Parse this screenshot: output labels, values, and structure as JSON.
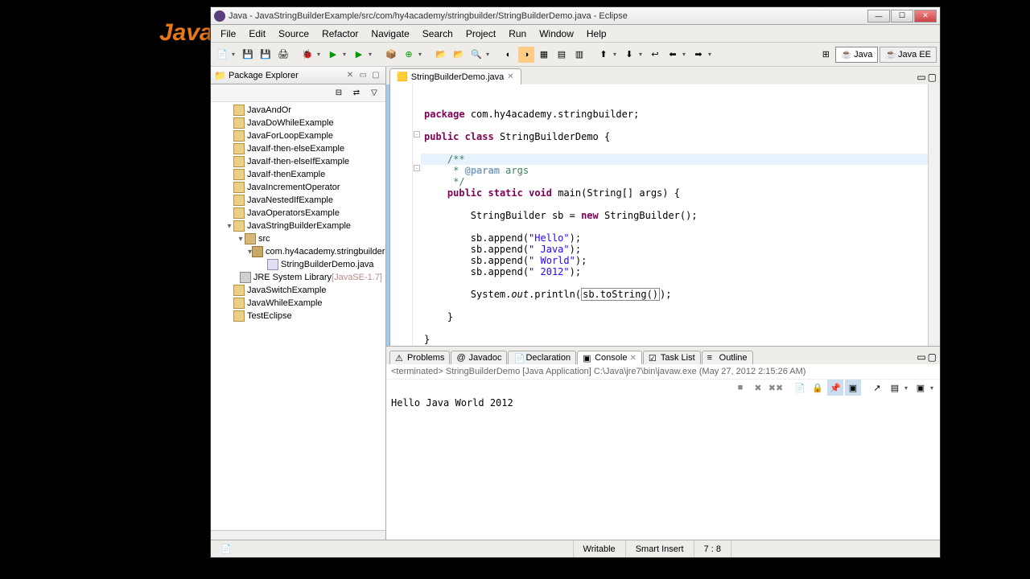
{
  "bg": "Java",
  "title": "Java - JavaStringBuilderExample/src/com/hy4academy/stringbuilder/StringBuilderDemo.java - Eclipse",
  "menu": [
    "File",
    "Edit",
    "Source",
    "Refactor",
    "Navigate",
    "Search",
    "Project",
    "Run",
    "Window",
    "Help"
  ],
  "persp": {
    "java": "Java",
    "javaee": "Java EE"
  },
  "pkg": {
    "title": "Package Explorer",
    "items": [
      {
        "l": "JavaAndOr",
        "t": "proj",
        "d": 1
      },
      {
        "l": "JavaDoWhileExample",
        "t": "proj",
        "d": 1
      },
      {
        "l": "JavaForLoopExample",
        "t": "proj",
        "d": 1
      },
      {
        "l": "JavaIf-then-elseExample",
        "t": "proj",
        "d": 1
      },
      {
        "l": "JavaIf-then-elseIfExample",
        "t": "proj",
        "d": 1
      },
      {
        "l": "JavaIf-thenExample",
        "t": "proj",
        "d": 1
      },
      {
        "l": "JavaIncrementOperator",
        "t": "proj",
        "d": 1
      },
      {
        "l": "JavaNestedIfExample",
        "t": "proj",
        "d": 1
      },
      {
        "l": "JavaOperatorsExample",
        "t": "proj",
        "d": 1
      },
      {
        "l": "JavaStringBuilderExample",
        "t": "proj",
        "d": 1,
        "exp": true
      },
      {
        "l": "src",
        "t": "src",
        "d": 2,
        "exp": true
      },
      {
        "l": "com.hy4academy.stringbuilder",
        "t": "pkg",
        "d": 3,
        "exp": true
      },
      {
        "l": "StringBuilderDemo.java",
        "t": "java",
        "d": 4
      },
      {
        "l": "JRE System Library",
        "t": "lib",
        "d": 2,
        "suffix": "[JavaSE-1.7]"
      },
      {
        "l": "JavaSwitchExample",
        "t": "proj",
        "d": 1
      },
      {
        "l": "JavaWhileExample",
        "t": "proj",
        "d": 1
      },
      {
        "l": "TestEclipse",
        "t": "proj",
        "d": 1
      }
    ]
  },
  "editor": {
    "tab": "StringBuilderDemo.java",
    "code": {
      "pkg": "package",
      "pkgname": "com.hy4academy.stringbuilder;",
      "pub": "public",
      "cls": "class",
      "clsname": "StringBuilderDemo {",
      "c1": "/**",
      "c2": " * ",
      "cparam": "@param",
      "cargs": " args",
      "c3": " */",
      "static": "static",
      "void": "void",
      "main": "main(String[] args) {",
      "sbdecl1": "StringBuilder sb = ",
      "new": "new",
      "sbdecl2": " StringBuilder();",
      "ap1a": "sb.append(",
      "ap1s": "\"Hello\"",
      "ap1b": ");",
      "ap2s": "\" Java\"",
      "ap3s": "\" World\"",
      "ap4s": "\" 2012\"",
      "out1": "System.",
      "out2": "out",
      "out3": ".println(",
      "out4": "sb.toString()",
      "out5": ");"
    }
  },
  "bottom": {
    "tabs": [
      "Problems",
      "Javadoc",
      "Declaration",
      "Console",
      "Task List",
      "Outline"
    ],
    "active": 3,
    "term": "<terminated> StringBuilderDemo [Java Application] C:\\Java\\jre7\\bin\\javaw.exe (May 27, 2012 2:15:26 AM)",
    "output": "Hello Java World 2012"
  },
  "status": {
    "writable": "Writable",
    "insert": "Smart Insert",
    "pos": "7 : 8"
  }
}
